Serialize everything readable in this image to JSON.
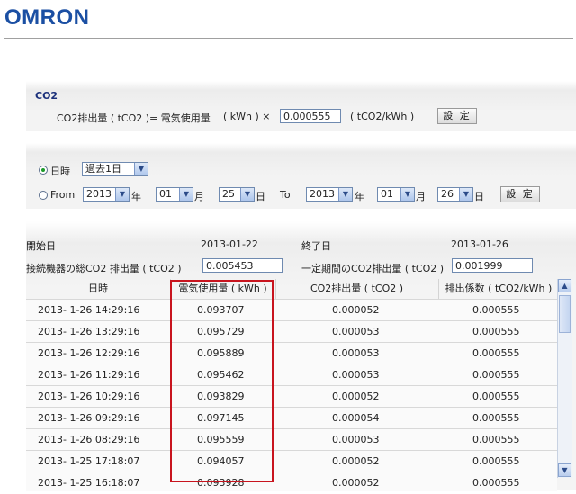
{
  "brand": {
    "logo": "OMRON"
  },
  "co2_settings": {
    "title": "CO2",
    "formula_left": "CO2排出量 ( tCO2 )= 電気使用量",
    "formula_unit": "( kWh ) ×",
    "factor_value": "0.000555",
    "factor_unit": "( tCO2/kWh )",
    "set_label": "設 定"
  },
  "period": {
    "mode_datetime_label": "日時",
    "recent_select": "過去1日",
    "mode_from_label": "From",
    "from_year": "2013",
    "year_label": "年",
    "from_month": "01",
    "month_label": "月",
    "from_day": "25",
    "day_label": "日",
    "to_label": "To",
    "to_year": "2013",
    "to_month": "01",
    "to_day": "26",
    "set_label": "設 定"
  },
  "summary": {
    "start_label": "開始日",
    "start_value": "2013-01-22",
    "end_label": "終了日",
    "end_value": "2013-01-26",
    "total_label": "接続機器の総CO2 排出量 ( tCO2 )",
    "total_value": "0.005453",
    "period_label": "一定期間のCO2排出量 ( tCO2 )",
    "period_value": "0.001999"
  },
  "table": {
    "headers": [
      "日時",
      "電気使用量 ( kWh )",
      "CO2排出量 ( tCO2 )",
      "排出係数 ( tCO2/kWh )"
    ],
    "rows": [
      [
        "2013- 1-26 14:29:16",
        "0.093707",
        "0.000052",
        "0.000555"
      ],
      [
        "2013- 1-26 13:29:16",
        "0.095729",
        "0.000053",
        "0.000555"
      ],
      [
        "2013- 1-26 12:29:16",
        "0.095889",
        "0.000053",
        "0.000555"
      ],
      [
        "2013- 1-26 11:29:16",
        "0.095462",
        "0.000053",
        "0.000555"
      ],
      [
        "2013- 1-26 10:29:16",
        "0.093829",
        "0.000052",
        "0.000555"
      ],
      [
        "2013- 1-26 09:29:16",
        "0.097145",
        "0.000054",
        "0.000555"
      ],
      [
        "2013- 1-26 08:29:16",
        "0.095559",
        "0.000053",
        "0.000555"
      ],
      [
        "2013- 1-25 17:18:07",
        "0.094057",
        "0.000052",
        "0.000555"
      ],
      [
        "2013- 1-25 16:18:07",
        "0.093928",
        "0.000052",
        "0.000555"
      ]
    ]
  },
  "colors": {
    "logo": "#1b4fa3",
    "highlight": "#c8141e",
    "title": "#1a2f7a"
  }
}
